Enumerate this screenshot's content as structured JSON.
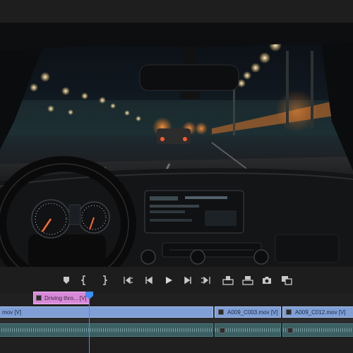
{
  "monitor": {
    "frame": "night-highway-car-interior"
  },
  "transport": {
    "buttons": [
      {
        "name": "add-marker-button",
        "icon": "marker-icon"
      },
      {
        "name": "mark-in-button",
        "icon": "mark-in-icon"
      },
      {
        "name": "mark-out-button",
        "icon": "mark-out-icon"
      },
      {
        "name": "go-to-in-button",
        "icon": "go-to-in-icon"
      },
      {
        "name": "step-back-button",
        "icon": "step-back-icon"
      },
      {
        "name": "play-button",
        "icon": "play-icon"
      },
      {
        "name": "step-forward-button",
        "icon": "step-forward-icon"
      },
      {
        "name": "go-to-out-button",
        "icon": "go-to-out-icon"
      },
      {
        "name": "lift-button",
        "icon": "lift-icon"
      },
      {
        "name": "extract-button",
        "icon": "extract-icon"
      },
      {
        "name": "export-frame-button",
        "icon": "camera-icon"
      },
      {
        "name": "comparison-view-button",
        "icon": "comparison-icon"
      }
    ]
  },
  "timeline": {
    "title_clip": {
      "label": "Driving thro... [V]"
    },
    "video_clips": [
      {
        "label": "mov [V]"
      },
      {
        "label": "A009_C003.mov [V]"
      },
      {
        "label": "A009_C012.mov [V]"
      }
    ]
  },
  "colors": {
    "title_clip": "#d88ad8",
    "video_clip": "#7f9fd6",
    "audio_clip": "#3a5e62",
    "playhead": "#3f8ef7"
  }
}
